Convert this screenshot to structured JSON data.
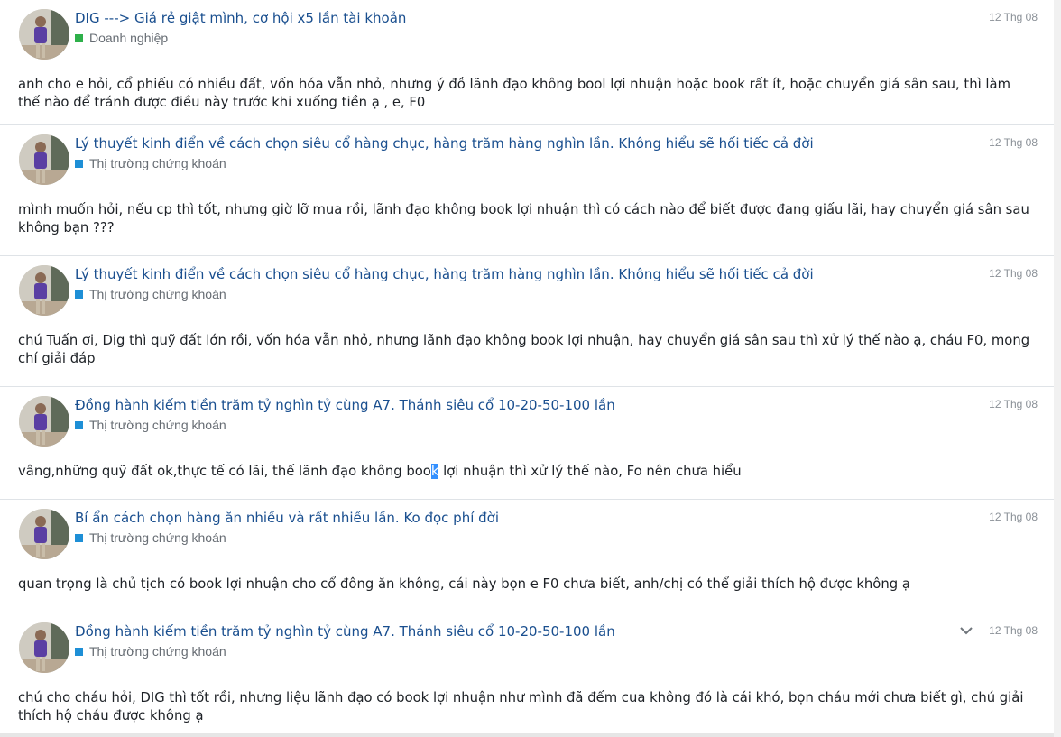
{
  "posts": [
    {
      "title": "DIG ---> Giá rẻ giật mình, cơ hội x5 lần tài khoản",
      "category": "Doanh nghiệp",
      "category_color": "#2eb04a",
      "date": "12 Thg 08",
      "body": "anh cho e hỏi, cổ phiếu có nhiều đất, vốn hóa vẫn nhỏ, nhưng ý đồ lãnh đạo không bool lợi nhuận hoặc book rất ít, hoặc chuyển giá sân sau, thì làm thế nào để tránh được điều này trước khi xuống tiền ạ , e, F0"
    },
    {
      "title": "Lý thuyết kinh điển về cách chọn siêu cổ hàng chục, hàng trăm hàng nghìn lần. Không hiểu sẽ hối tiếc cả đời",
      "category": "Thị trường chứng khoán",
      "category_color": "#1e8fd6",
      "date": "12 Thg 08",
      "body": "mình muốn hỏi, nếu cp thì tốt, nhưng giờ lỡ mua rồi, lãnh đạo không book lợi nhuận thì có cách nào để biết được đang giấu lãi, hay chuyển giá sân sau không bạn ???"
    },
    {
      "title": "Lý thuyết kinh điển về cách chọn siêu cổ hàng chục, hàng trăm hàng nghìn lần. Không hiểu sẽ hối tiếc cả đời",
      "category": "Thị trường chứng khoán",
      "category_color": "#1e8fd6",
      "date": "12 Thg 08",
      "body": "chú Tuấn ơi, Dig thì quỹ đất lớn rồi, vốn hóa vẫn nhỏ, nhưng lãnh đạo không book lợi nhuận, hay chuyển giá sân sau thì xử lý thế nào ạ, cháu F0, mong chí giải đáp"
    },
    {
      "title": "Đồng hành kiếm tiền trăm tỷ nghìn tỷ cùng A7. Thánh siêu cổ 10-20-50-100 lần",
      "category": "Thị trường chứng khoán",
      "category_color": "#1e8fd6",
      "date": "12 Thg 08",
      "body_before": "vâng,những quỹ đất ok,thực tế có lãi, thế lãnh đạo không boo",
      "body_highlight": "k",
      "body_after": " lợi nhuận thì xử lý thế nào, Fo nên chưa hiểu"
    },
    {
      "title": "Bí ẩn cách chọn hàng ăn nhiều và rất nhiều lần. Ko đọc phí đời",
      "category": "Thị trường chứng khoán",
      "category_color": "#1e8fd6",
      "date": "12 Thg 08",
      "body": "quan trọng là chủ tịch có book lợi nhuận cho cổ đông ăn không, cái này bọn e F0 chưa biết, anh/chị có thể giải thích hộ được không ạ"
    },
    {
      "title": "Đồng hành kiếm tiền trăm tỷ nghìn tỷ cùng A7. Thánh siêu cổ 10-20-50-100 lần",
      "category": "Thị trường chứng khoán",
      "category_color": "#1e8fd6",
      "date": "12 Thg 08",
      "body": "chú cho cháu hỏi, DIG thì tốt rồi, nhưng liệu lãnh đạo có book lợi nhuận như mình đã đếm cua không đó là cái khó, bọn cháu mới chưa biết gì, chú giải thích hộ cháu được không ạ"
    }
  ]
}
